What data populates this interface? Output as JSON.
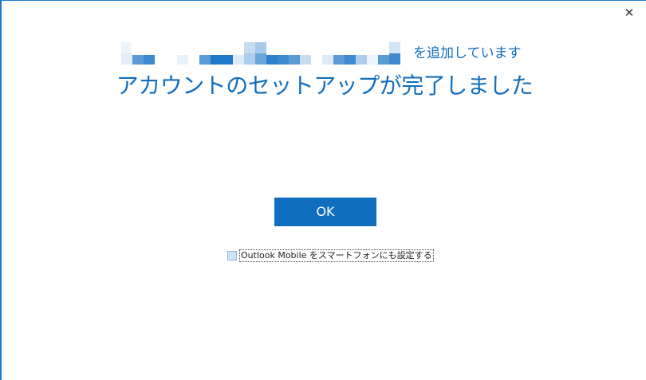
{
  "window": {
    "close_glyph": "✕"
  },
  "header": {
    "subtitle_suffix": "を追加しています",
    "title": "アカウントのセットアップが完了しました"
  },
  "actions": {
    "ok_label": "OK"
  },
  "option": {
    "checkbox_label": "Outlook Mobile をスマートフォンにも設定する",
    "checked": false
  },
  "colors": {
    "accent": "#106ebe",
    "window_border": "#1979ca",
    "checkbox_fill": "#cfe3f6"
  }
}
